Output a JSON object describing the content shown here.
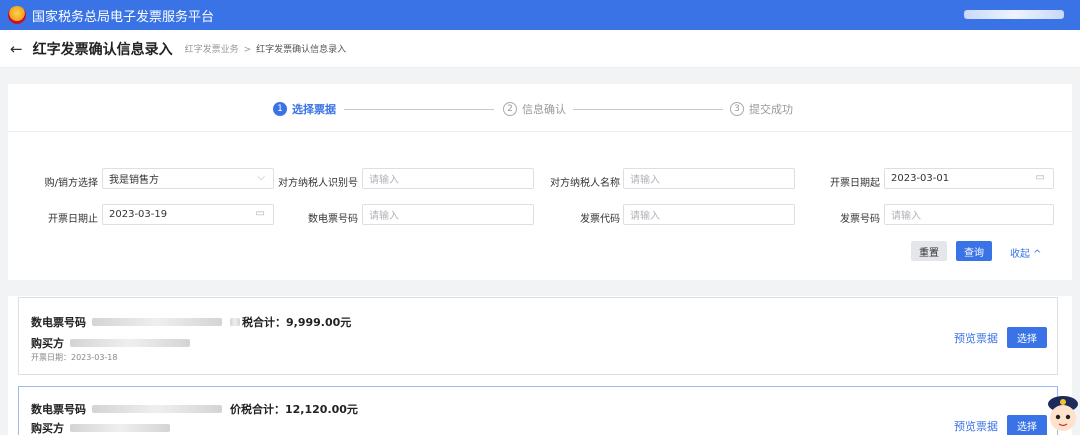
{
  "header": {
    "brand": "国家税务总局电子发票服务平台"
  },
  "titlebar": {
    "back_icon": "←",
    "title": "红字发票确认信息录入",
    "breadcrumb": [
      "红字发票业务",
      "红字发票确认信息录入"
    ],
    "breadcrumb_sep": ">"
  },
  "steps": [
    {
      "num": "1",
      "label": "选择票据",
      "state": "active"
    },
    {
      "num": "2",
      "label": "信息确认",
      "state": "inactive"
    },
    {
      "num": "3",
      "label": "提交成功",
      "state": "inactive"
    }
  ],
  "form": {
    "buyer_seller": {
      "label": "购/销方选择",
      "value": "我是销售方"
    },
    "counterparty_id": {
      "label": "对方纳税人识别号",
      "placeholder": "请输入"
    },
    "counterparty_name": {
      "label": "对方纳税人名称",
      "placeholder": "请输入"
    },
    "date_from": {
      "label": "开票日期起",
      "value": "2023-03-01"
    },
    "date_to": {
      "label": "开票日期止",
      "value": "2023-03-19"
    },
    "e_invoice_no": {
      "label": "数电票号码",
      "placeholder": "请输入"
    },
    "invoice_code": {
      "label": "发票代码",
      "placeholder": "请输入"
    },
    "invoice_no": {
      "label": "发票号码",
      "placeholder": "请输入"
    },
    "reset_label": "重置",
    "query_label": "查询",
    "collapse_label": "收起 ^"
  },
  "invoices": [
    {
      "no_label": "数电票号码",
      "total_label": "税合计：9,999.00元",
      "buyer_label": "购买方",
      "date_text": "开票日期：2023-03-18",
      "preview_label": "预览票据",
      "select_label": "选择"
    },
    {
      "no_label": "数电票号码",
      "total_label": "价税合计：12,120.00元",
      "buyer_label": "购买方",
      "preview_label": "预览票据",
      "select_label": "选择"
    }
  ],
  "colors": {
    "primary": "#3a73e6",
    "topbar": "#3a73e6"
  },
  "icons": {
    "calendar": "calendar-icon",
    "chevron": "chevron-down-icon"
  }
}
